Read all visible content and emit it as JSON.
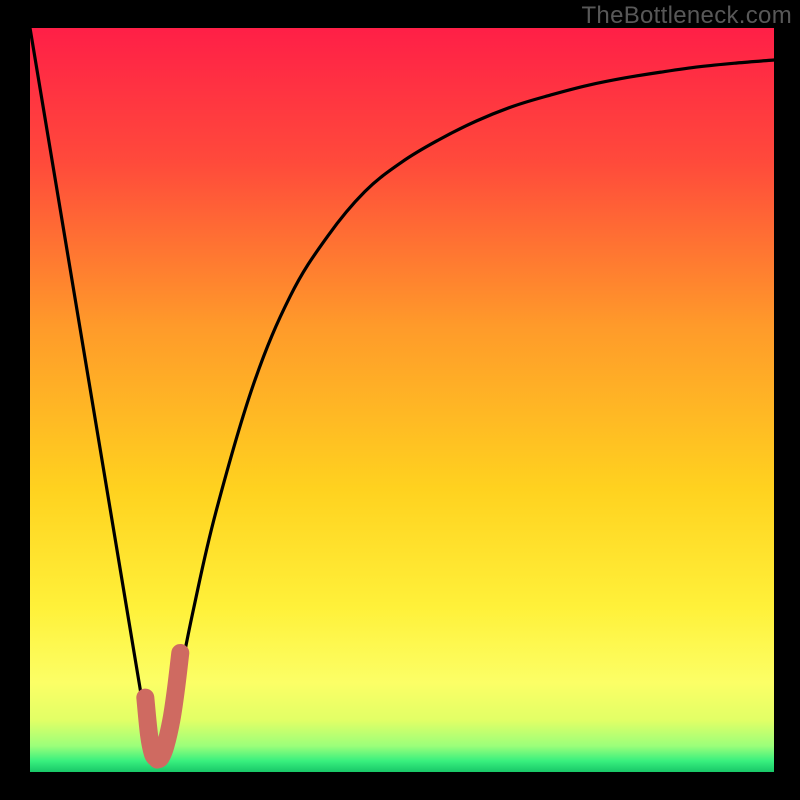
{
  "watermark": "TheBottleneck.com",
  "chart_data": {
    "type": "line",
    "title": "",
    "xlabel": "",
    "ylabel": "",
    "x_range": [
      0,
      100
    ],
    "y_range": [
      0,
      100
    ],
    "series": [
      {
        "name": "bottleneck-curve",
        "x": [
          0,
          5,
          10,
          12,
          14,
          15,
          16,
          17,
          18,
          19,
          20,
          22,
          25,
          30,
          35,
          40,
          45,
          50,
          55,
          60,
          65,
          70,
          75,
          80,
          85,
          90,
          95,
          100
        ],
        "values": [
          100,
          70,
          40,
          28,
          16,
          10,
          4,
          2,
          3,
          6,
          12,
          22,
          35,
          52,
          64,
          72,
          78,
          82,
          85,
          87.5,
          89.5,
          91,
          92.3,
          93.3,
          94.1,
          94.8,
          95.3,
          95.7
        ]
      },
      {
        "name": "marker-J",
        "x": [
          15.5,
          16,
          16.5,
          17,
          17.2,
          17.6,
          18.2,
          19.0,
          19.6,
          20.2
        ],
        "values": [
          10.0,
          5.0,
          2.5,
          1.8,
          1.7,
          2.0,
          3.5,
          7.0,
          11.0,
          16.0
        ]
      }
    ],
    "gradient_stops": [
      {
        "offset": 0.0,
        "color": "#ff1f47"
      },
      {
        "offset": 0.18,
        "color": "#ff4a3b"
      },
      {
        "offset": 0.4,
        "color": "#ff9a2a"
      },
      {
        "offset": 0.62,
        "color": "#ffd21f"
      },
      {
        "offset": 0.78,
        "color": "#fff13a"
      },
      {
        "offset": 0.88,
        "color": "#fcff66"
      },
      {
        "offset": 0.93,
        "color": "#e2ff66"
      },
      {
        "offset": 0.965,
        "color": "#9bff7a"
      },
      {
        "offset": 0.985,
        "color": "#39f07e"
      },
      {
        "offset": 1.0,
        "color": "#18c768"
      }
    ],
    "frame": {
      "outer": 800,
      "inner_left": 30,
      "inner_top": 28,
      "inner_size": 744
    },
    "styles": {
      "curve_stroke": "#000000",
      "curve_width": 3.2,
      "marker_stroke": "#cf6a61",
      "marker_width": 18,
      "marker_linecap": "round"
    }
  }
}
